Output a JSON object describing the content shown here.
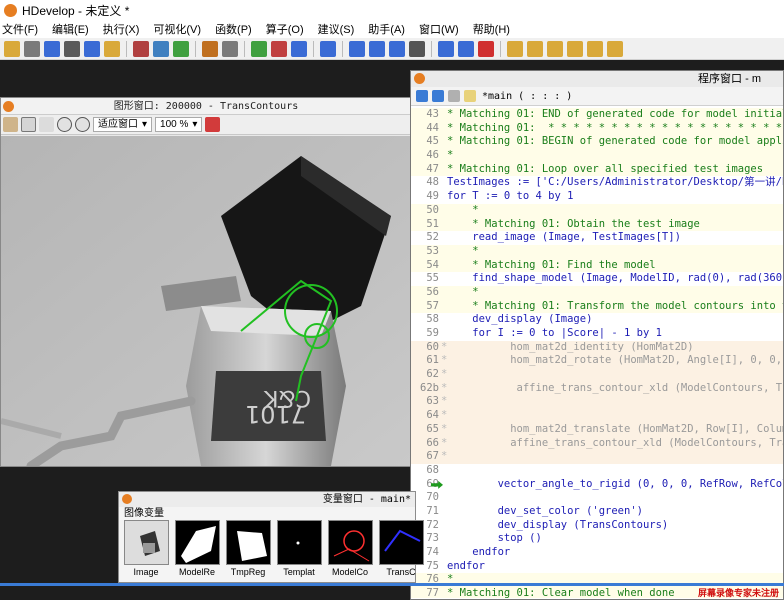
{
  "app": {
    "title": "HDevelop - 未定义 *"
  },
  "menu": [
    "文件(F)",
    "编辑(E)",
    "执行(X)",
    "可视化(V)",
    "函数(P)",
    "算子(O)",
    "建议(S)",
    "助手(A)",
    "窗口(W)",
    "帮助(H)"
  ],
  "graphics_window": {
    "title": "图形窗口: 200000 - TransContours",
    "fit_label": "适应窗口",
    "zoom_label": "100 %"
  },
  "program_window": {
    "title": "程序窗口 - m",
    "procedure": "*main ( : : : )"
  },
  "code_lines": [
    {
      "n": "43",
      "t": "* Matching 01: END of generated code for model initiali",
      "k": "comment"
    },
    {
      "n": "44",
      "t": "* Matching 01:  * * * * * * * * * * * * * * * * * * * *",
      "k": "comment"
    },
    {
      "n": "45",
      "t": "* Matching 01: BEGIN of generated code for model applic",
      "k": "comment"
    },
    {
      "n": "46",
      "t": "*",
      "k": "comment"
    },
    {
      "n": "47",
      "t": "* Matching 01: Loop over all specified test images",
      "k": "comment"
    },
    {
      "n": "48",
      "t": "TestImages := ['C:/Users/Administrator/Desktop/第一讲/b",
      "k": "code"
    },
    {
      "n": "49",
      "t": "for T := 0 to 4 by 1",
      "k": "code"
    },
    {
      "n": "50",
      "t": "    *",
      "k": "comment"
    },
    {
      "n": "51",
      "t": "    * Matching 01: Obtain the test image",
      "k": "comment"
    },
    {
      "n": "52",
      "t": "    read_image (Image, TestImages[T])",
      "k": "code"
    },
    {
      "n": "53",
      "t": "    *",
      "k": "comment"
    },
    {
      "n": "54",
      "t": "    * Matching 01: Find the model",
      "k": "comment"
    },
    {
      "n": "55",
      "t": "    find_shape_model (Image, ModelID, rad(0), rad(360),",
      "k": "code"
    },
    {
      "n": "56",
      "t": "    *",
      "k": "comment"
    },
    {
      "n": "57",
      "t": "    * Matching 01: Transform the model contours into th",
      "k": "comment"
    },
    {
      "n": "58",
      "t": "    dev_display (Image)",
      "k": "code"
    },
    {
      "n": "59",
      "t": "    for I := 0 to |Score| - 1 by 1",
      "k": "code"
    },
    {
      "n": "60",
      "t": "          hom_mat2d_identity (HomMat2D)",
      "k": "disabled"
    },
    {
      "n": "61",
      "t": "          hom_mat2d_rotate (HomMat2D, Angle[I], 0, 0, H",
      "k": "disabled"
    },
    {
      "n": "62",
      "t": "",
      "k": "disabled"
    },
    {
      "n": "62b",
      "t": "           affine_trans_contour_xld (ModelContours, Tr",
      "k": "disabled"
    },
    {
      "n": "63",
      "t": "",
      "k": "disabled"
    },
    {
      "n": "64",
      "t": "",
      "k": "disabled"
    },
    {
      "n": "65",
      "t": "          hom_mat2d_translate (HomMat2D, Row[I], Column",
      "k": "disabled"
    },
    {
      "n": "66",
      "t": "          affine_trans_contour_xld (ModelContours, Tran",
      "k": "disabled"
    },
    {
      "n": "67",
      "t": "",
      "k": "disabled"
    },
    {
      "n": "68",
      "t": "",
      "k": "pc"
    },
    {
      "n": "69",
      "t": "        vector_angle_to_rigid (0, 0, 0, RefRow, RefColu",
      "k": "code"
    },
    {
      "n": "70",
      "t": "",
      "k": "pc"
    },
    {
      "n": "71",
      "t": "        dev_set_color ('green')",
      "k": "code"
    },
    {
      "n": "72",
      "t": "        dev_display (TransContours)",
      "k": "code"
    },
    {
      "n": "73",
      "t": "        stop ()",
      "k": "code"
    },
    {
      "n": "74",
      "t": "    endfor",
      "k": "code"
    },
    {
      "n": "75",
      "t": "endfor",
      "k": "code"
    },
    {
      "n": "76",
      "t": "*",
      "k": "comment"
    },
    {
      "n": "77",
      "t": "* Matching 01: Clear model when done",
      "k": "comment"
    }
  ],
  "variable_window": {
    "title": "变量窗口 - main*",
    "section": "图像变量",
    "vars": [
      "Image",
      "ModelRe",
      "TmpReg",
      "Templat",
      "ModelCo",
      "TransC"
    ]
  },
  "watermark": "屏幕录像专家未注册",
  "colors": {
    "accent": "#e67e22",
    "comment": "#1a7e1a",
    "keyword": "#1c1cb4",
    "contour": "#22c022"
  }
}
